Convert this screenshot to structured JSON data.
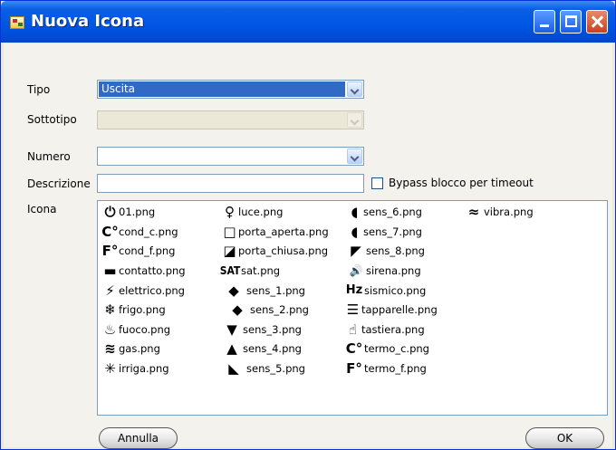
{
  "window": {
    "title": "Nuova Icona"
  },
  "form": {
    "tipo_label": "Tipo",
    "tipo_value": "Uscita",
    "sottotipo_label": "Sottotipo",
    "sottotipo_value": "",
    "numero_label": "Numero",
    "numero_value": "",
    "descrizione_label": "Descrizione",
    "descrizione_value": "",
    "bypass_label": "Bypass blocco per timeout",
    "bypass_checked": false,
    "icona_label": "Icona"
  },
  "icons": [
    {
      "glyph": "⏻",
      "name": "01.png",
      "icon": "power-icon"
    },
    {
      "glyph": "C°",
      "name": "cond_c.png",
      "icon": "celsius-icon"
    },
    {
      "glyph": "F°",
      "name": "cond_f.png",
      "icon": "fahrenheit-icon"
    },
    {
      "glyph": "▬",
      "name": "contatto.png",
      "icon": "contact-icon"
    },
    {
      "glyph": "⚡",
      "name": "elettrico.png",
      "icon": "electric-icon"
    },
    {
      "glyph": "❄",
      "name": "frigo.png",
      "icon": "snowflake-icon"
    },
    {
      "glyph": "♨",
      "name": "fuoco.png",
      "icon": "fire-icon"
    },
    {
      "glyph": "≋",
      "name": "gas.png",
      "icon": "gas-icon"
    },
    {
      "glyph": "✳",
      "name": "irriga.png",
      "icon": "irrigation-icon"
    },
    {
      "glyph": "♀",
      "name": "luce.png",
      "icon": "light-bulb-icon"
    },
    {
      "glyph": "□",
      "name": "porta_aperta.png",
      "icon": "door-open-icon"
    },
    {
      "glyph": "◪",
      "name": "porta_chiusa.png",
      "icon": "door-closed-icon"
    },
    {
      "glyph": "SAT",
      "name": "sat.png",
      "icon": "satellite-text-icon"
    },
    {
      "glyph": "◆",
      "name": "sens_1.png",
      "icon": "sensor-1-icon"
    },
    {
      "glyph": "◆",
      "name": "sens_2.png",
      "icon": "sensor-2-icon"
    },
    {
      "glyph": "▼",
      "name": "sens_3.png",
      "icon": "sensor-3-icon"
    },
    {
      "glyph": "▲",
      "name": "sens_4.png",
      "icon": "sensor-4-icon"
    },
    {
      "glyph": "◣",
      "name": "sens_5.png",
      "icon": "sensor-5-icon"
    },
    {
      "glyph": "◖",
      "name": "sens_6.png",
      "icon": "sensor-6-icon"
    },
    {
      "glyph": "◖",
      "name": "sens_7.png",
      "icon": "sensor-7-icon"
    },
    {
      "glyph": "◤",
      "name": "sens_8.png",
      "icon": "sensor-8-icon"
    },
    {
      "glyph": "🔊",
      "name": "sirena.png",
      "icon": "siren-icon"
    },
    {
      "glyph": "Hz",
      "name": "sismico.png",
      "icon": "seismic-icon"
    },
    {
      "glyph": "☰",
      "name": "tapparelle.png",
      "icon": "shutter-icon"
    },
    {
      "glyph": "☝",
      "name": "tastiera.png",
      "icon": "keypad-icon"
    },
    {
      "glyph": "C°",
      "name": "termo_c.png",
      "icon": "thermo-celsius-icon"
    },
    {
      "glyph": "F°",
      "name": "termo_f.png",
      "icon": "thermo-fahrenheit-icon"
    },
    {
      "glyph": "≈",
      "name": "vibra.png",
      "icon": "vibration-icon"
    }
  ],
  "buttons": {
    "cancel": "Annulla",
    "ok": "OK"
  }
}
